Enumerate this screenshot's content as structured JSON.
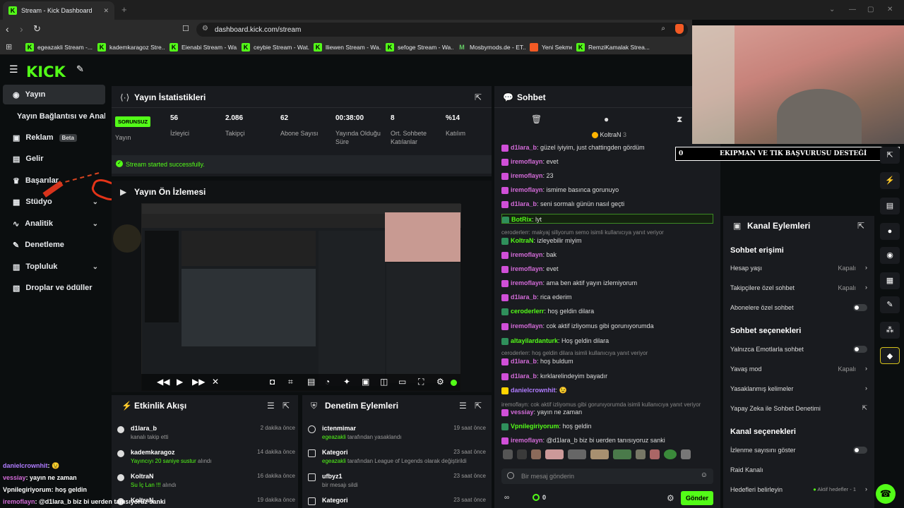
{
  "browser": {
    "tab_title": "Stream - Kick Dashboard",
    "url": "dashboard.kick.com/stream",
    "bookmarks": [
      "egeazakli Stream -...",
      "kademkaragoz Stre...",
      "Eienabi Stream - Wa...",
      "ceybie Stream - Wat...",
      "lliewen Stream - Wa...",
      "sefoge Stream - Wa...",
      "Mosbymods.de - ET...",
      "Yeni Sekme",
      "RemziKamalak Strea..."
    ]
  },
  "sidebar": {
    "items": [
      {
        "label": "Yayın"
      },
      {
        "label": "Yayın Bağlantısı ve Anahtarı"
      },
      {
        "label": "Reklam",
        "badge": "Beta"
      },
      {
        "label": "Gelir"
      },
      {
        "label": "Başarılar"
      },
      {
        "label": "Stüdyo"
      },
      {
        "label": "Analitik"
      },
      {
        "label": "Denetleme"
      },
      {
        "label": "Topluluk"
      },
      {
        "label": "Droplar ve ödüller"
      }
    ]
  },
  "stats": {
    "title": "Yayın İstatistikleri",
    "status_badge": "SORUNSUZ",
    "status_label": "Yayın",
    "items": [
      {
        "value": "56",
        "label": "İzleyici"
      },
      {
        "value": "2.086",
        "label": "Takipçi"
      },
      {
        "value": "62",
        "label": "Abone Sayısı"
      },
      {
        "value": "00:38:00",
        "label": "Yayında Olduğu Süre"
      },
      {
        "value": "8",
        "label": "Ort. Sohbete Katılanlar"
      },
      {
        "value": "%14",
        "label": "Katılım"
      }
    ],
    "success_msg": "Stream started successfully."
  },
  "preview": {
    "title": "Yayın Ön İzlemesi"
  },
  "activity": {
    "title": "Etkinlik Akışı",
    "rows": [
      {
        "name": "d1lara_b",
        "sub": "kanalı takip etti",
        "time": "2 dakika önce"
      },
      {
        "name": "kademkaragoz",
        "sub_green": "Yayıncıyı 20 saniye sustur",
        "sub": "alındı",
        "time": "14 dakika önce"
      },
      {
        "name": "KoltraN",
        "sub_green": "Su İç Lan !!!",
        "sub": "alındı",
        "time": "16 dakika önce"
      },
      {
        "name": "KoltraN",
        "sub": "",
        "time": "19 dakika önce"
      }
    ]
  },
  "moderation": {
    "title": "Denetim Eylemleri",
    "rows": [
      {
        "name": "ictenmimar",
        "sub_green": "egeazakli",
        "sub": "tarafından yasaklandı",
        "time": "19 saat önce"
      },
      {
        "name": "Kategori",
        "sub_green": "egeazakli",
        "sub": "tarafından League of Legends olarak değiştirildi",
        "time": "23 saat önce"
      },
      {
        "name": "ufbyz1",
        "sub": "bir mesajı sildi",
        "time": "23 saat önce"
      },
      {
        "name": "Kategori",
        "sub_green": "egeazakli",
        "sub": "tarafından Just Chatting olarak değiştirildi",
        "time": "23 saat önce"
      }
    ]
  },
  "chat": {
    "title": "Sohbet",
    "pinned": "KoltraN",
    "pinned_count": "3",
    "messages": [
      {
        "user": "d1lara_b",
        "color": "pink",
        "text": "güzel iyiyim, just chattingden gördüm"
      },
      {
        "user": "iremoflayn",
        "color": "pink",
        "text": "evet"
      },
      {
        "user": "iremoflayn",
        "color": "pink",
        "text": "23"
      },
      {
        "user": "iremoflayn",
        "color": "pink",
        "text": "ismime basınca gorunuyo"
      },
      {
        "user": "d1lara_b",
        "color": "pink",
        "text": "seni sormalı günün nasıl geçti"
      },
      {
        "user": "BotRix",
        "color": "green",
        "text": "lyt"
      },
      {
        "system": "ceroderlerr: makyaj siliyorum semo isimli kullanıcıya yanıt veriyor"
      },
      {
        "user": "KoltraN",
        "color": "green",
        "text": "izleyebilir miyim"
      },
      {
        "user": "iremoflayn",
        "color": "pink",
        "text": "bak"
      },
      {
        "user": "iremoflayn",
        "color": "pink",
        "text": "evet"
      },
      {
        "user": "iremoflayn",
        "color": "pink",
        "text": "ama ben aktif yayın izlemiyorum"
      },
      {
        "user": "d1lara_b",
        "color": "pink",
        "text": "rica ederim"
      },
      {
        "user": "ceroderlerr",
        "color": "green",
        "text": "hoş geldin dilara"
      },
      {
        "user": "iremoflayn",
        "color": "pink",
        "text": "cok aktif izliyomus gibi gorunıyorumda"
      },
      {
        "user": "altayilardanturk",
        "color": "green",
        "text": "Hoş geldin dilara"
      },
      {
        "system": "ceroderlerr: hoş geldin dilara isimli kullanıcıya yanıt veriyor"
      },
      {
        "user": "d1lara_b",
        "color": "pink",
        "text": "hoş buldum"
      },
      {
        "user": "d1lara_b",
        "color": "pink",
        "text": "kırklarelindeyim bayadır"
      },
      {
        "user": "danielcrownhit",
        "color": "purple",
        "text": "😉"
      },
      {
        "system": "iremoflayn: cok aktif izliyomus gibi gorunıyorumda isimli kullanıcıya yanıt veriyor"
      },
      {
        "user": "vessiay",
        "color": "pink",
        "text": "yayın ne zaman"
      },
      {
        "user": "Vpnilegiriyorum",
        "color": "green",
        "text": "hoş geldin"
      },
      {
        "user": "iremoflayn",
        "color": "pink",
        "text": "@d1lara_b biz bi uerden tanısıyoruz sanki"
      }
    ],
    "input_placeholder": "Bir mesaj gönderin",
    "points": "0",
    "send_label": "Gönder"
  },
  "overlay": {
    "banner_left": "0",
    "banner_text": "EKIPMAN VE TIK BAŞVURUSU DESTEĞİ",
    "banner_right": "10",
    "chat": [
      {
        "user": "danielcrownhit",
        "text": ":"
      },
      {
        "user": "vessiay",
        "text": ": yayın ne zaman"
      },
      {
        "user": "Vpnilegiriyorum",
        "text": ": hoş geldin"
      },
      {
        "user": "iremoflayn",
        "text": ": @d1lara_b biz bi uerden tanısıyoruz sanki"
      }
    ]
  },
  "channel_actions": {
    "title": "Kanal Eylemleri",
    "section1": "Sohbet erişimi",
    "account_age": "Hesap yaşı",
    "account_age_val": "Kapalı",
    "followers_only": "Takipçilere özel sohbet",
    "followers_only_val": "Kapalı",
    "subs_only": "Abonelere özel sohbet",
    "section2": "Sohbet seçenekleri",
    "emote_only": "Yalnızca Emotlarla sohbet",
    "slow_mode": "Yavaş mod",
    "slow_mode_val": "Kapalı",
    "banned_words": "Yasaklanmış kelimeler",
    "ai_mod": "Yapay Zeka ile Sohbet Denetimi",
    "section3": "Kanal seçenekleri",
    "show_viewers": "İzlenme sayısını göster",
    "raid": "Raid Kanalı",
    "goals": "Hedefleri belirleyin",
    "goals_val": "Aktif hedefler - 1"
  }
}
